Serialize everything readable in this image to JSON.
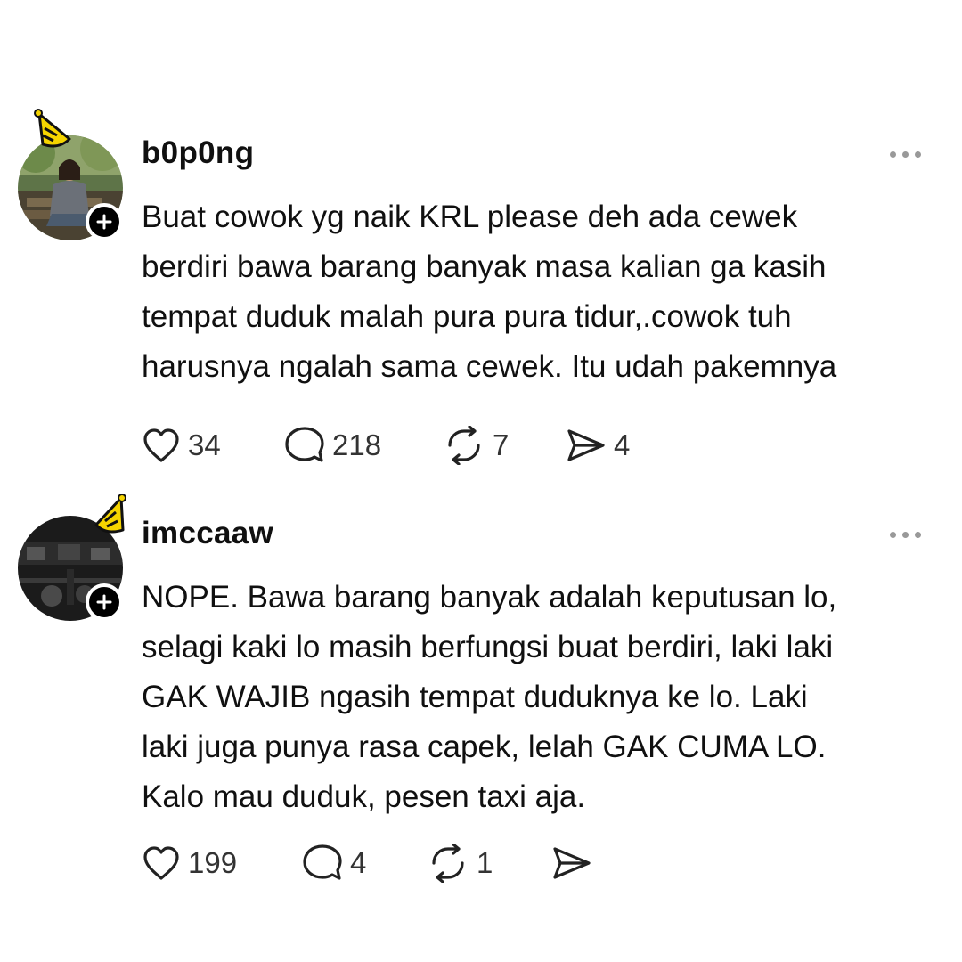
{
  "posts": [
    {
      "username": "b0p0ng",
      "text": "Buat cowok yg naik KRL please deh ada cewek\nberdiri bawa barang banyak masa kalian ga kasih\ntempat duduk malah pura pura tidur,.cowok tuh\nharusnya ngalah sama cewek. Itu udah pakemnya",
      "likes": "34",
      "replies": "218",
      "reposts": "7",
      "shares": "4"
    },
    {
      "username": "imccaaw",
      "text": "NOPE. Bawa barang banyak adalah keputusan lo,\nselagi kaki lo masih berfungsi buat berdiri, laki laki\nGAK WAJIB ngasih tempat duduknya ke lo. Laki\nlaki juga punya rasa capek, lelah GAK CUMA LO.\nKalo mau duduk, pesen taxi aja.",
      "likes": "199",
      "replies": "4",
      "reposts": "1",
      "shares": ""
    }
  ],
  "icons": {
    "like": "heart-icon",
    "reply": "comment-icon",
    "repost": "repost-icon",
    "share": "send-icon",
    "more": "more-icon",
    "follow": "plus-icon",
    "hat": "party-hat-icon"
  },
  "colors": {
    "text": "#101010",
    "muted": "#999999",
    "hat_yellow": "#f5d400"
  }
}
